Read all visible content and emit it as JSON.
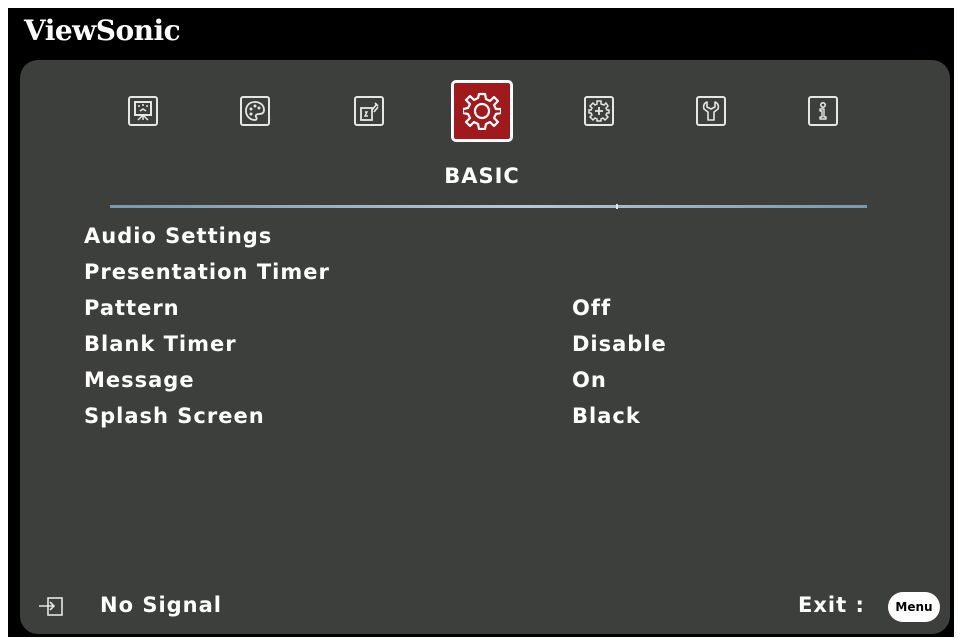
{
  "brand": "ViewSonic",
  "tabs": [
    {
      "id": "display",
      "icon": "display-icon",
      "selected": false
    },
    {
      "id": "image-setting",
      "icon": "palette-icon",
      "selected": false
    },
    {
      "id": "power-management",
      "icon": "power-plug-icon",
      "selected": false
    },
    {
      "id": "basic",
      "icon": "gear-icon",
      "selected": true
    },
    {
      "id": "advanced",
      "icon": "advanced-gear-icon",
      "selected": false
    },
    {
      "id": "system",
      "icon": "wrench-icon",
      "selected": false
    },
    {
      "id": "information",
      "icon": "info-icon",
      "selected": false
    }
  ],
  "selected_tab_label": "BASIC",
  "menu": {
    "items": [
      {
        "label": "Audio Settings",
        "value": ""
      },
      {
        "label": "Presentation Timer",
        "value": ""
      },
      {
        "label": "Pattern",
        "value": "Off"
      },
      {
        "label": "Blank Timer",
        "value": "Disable"
      },
      {
        "label": "Message",
        "value": "On"
      },
      {
        "label": "Splash Screen",
        "value": "Black"
      }
    ]
  },
  "footer": {
    "input_icon": "input-source-icon",
    "signal_status": "No Signal",
    "exit_label": "Exit :",
    "menu_button": "Menu"
  },
  "colors": {
    "background": "#3c3f3c",
    "frame": "#000000",
    "selected_tab": "#a0191c",
    "text": "#ffffff"
  }
}
